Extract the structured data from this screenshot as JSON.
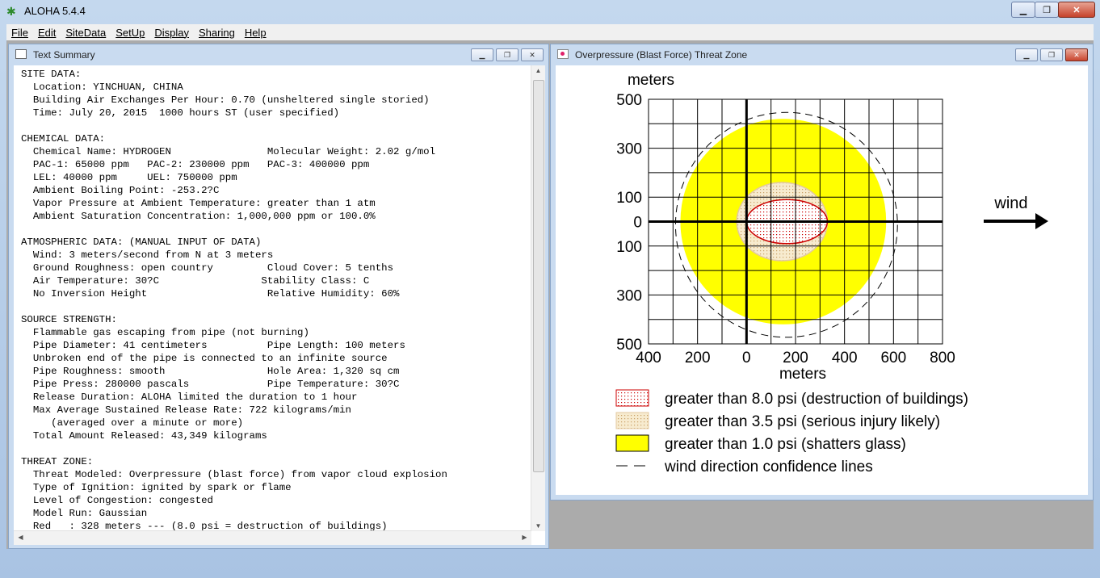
{
  "app": {
    "title": "ALOHA 5.4.4"
  },
  "menu": [
    "File",
    "Edit",
    "SiteData",
    "SetUp",
    "Display",
    "Sharing",
    "Help"
  ],
  "text_window": {
    "title": "Text Summary",
    "lines": [
      "SITE DATA:",
      "  Location: YINCHUAN, CHINA",
      "  Building Air Exchanges Per Hour: 0.70 (unsheltered single storied)",
      "  Time: July 20, 2015  1000 hours ST (user specified)",
      "",
      "CHEMICAL DATA:",
      "  Chemical Name: HYDROGEN                Molecular Weight: 2.02 g/mol",
      "  PAC-1: 65000 ppm   PAC-2: 230000 ppm   PAC-3: 400000 ppm",
      "  LEL: 40000 ppm     UEL: 750000 ppm",
      "  Ambient Boiling Point: -253.2?C",
      "  Vapor Pressure at Ambient Temperature: greater than 1 atm",
      "  Ambient Saturation Concentration: 1,000,000 ppm or 100.0%",
      "",
      "ATMOSPHERIC DATA: (MANUAL INPUT OF DATA)",
      "  Wind: 3 meters/second from N at 3 meters",
      "  Ground Roughness: open country         Cloud Cover: 5 tenths",
      "  Air Temperature: 30?C                 Stability Class: C",
      "  No Inversion Height                    Relative Humidity: 60%",
      "",
      "SOURCE STRENGTH:",
      "  Flammable gas escaping from pipe (not burning)",
      "  Pipe Diameter: 41 centimeters          Pipe Length: 100 meters",
      "  Unbroken end of the pipe is connected to an infinite source",
      "  Pipe Roughness: smooth                 Hole Area: 1,320 sq cm",
      "  Pipe Press: 280000 pascals             Pipe Temperature: 30?C",
      "  Release Duration: ALOHA limited the duration to 1 hour",
      "  Max Average Sustained Release Rate: 722 kilograms/min",
      "     (averaged over a minute or more)",
      "  Total Amount Released: 43,349 kilograms",
      "",
      "THREAT ZONE:",
      "  Threat Modeled: Overpressure (blast force) from vapor cloud explosion",
      "  Type of Ignition: ignited by spark or flame",
      "  Level of Congestion: congested",
      "  Model Run: Gaussian",
      "  Red   : 328 meters --- (8.0 psi = destruction of buildings)"
    ]
  },
  "threat_window": {
    "title": "Overpressure (Blast Force) Threat Zone",
    "y_axis_label": "meters",
    "x_axis_label": "meters",
    "wind_label": "wind",
    "colors": {
      "red": "#cc0000",
      "orange": "#f5deb3",
      "yellow": "#ffff00"
    },
    "legend": [
      {
        "label": "greater than 8.0 psi (destruction of buildings)",
        "swatch": "red-dots"
      },
      {
        "label": "greater than 3.5 psi (serious injury likely)",
        "swatch": "orange-dots"
      },
      {
        "label": "greater than 1.0 psi (shatters glass)",
        "swatch": "yellow"
      },
      {
        "label": "wind direction confidence lines",
        "swatch": "dashed"
      }
    ]
  },
  "chart_data": {
    "type": "area",
    "x_ticks": [
      "400",
      "200",
      "0",
      "200",
      "400",
      "600",
      "800"
    ],
    "y_ticks": [
      "500",
      "300",
      "100",
      "0",
      "100",
      "300",
      "500"
    ],
    "xlim": [
      -400,
      800
    ],
    "ylim": [
      -500,
      500
    ],
    "grid": true,
    "zones": [
      {
        "name": "greater than 1.0 psi (shatters glass)",
        "x_extent": [
          -270,
          570
        ],
        "y_extent": [
          -420,
          420
        ],
        "color": "#ffff00"
      },
      {
        "name": "greater than 3.5 psi (serious injury likely)",
        "x_extent": [
          -40,
          330
        ],
        "y_extent": [
          -160,
          160
        ],
        "color": "#f5deb3"
      },
      {
        "name": "greater than 8.0 psi (destruction of buildings)",
        "x_extent": [
          0,
          330
        ],
        "y_extent": [
          -90,
          90
        ],
        "color": "#cc0000"
      }
    ]
  }
}
